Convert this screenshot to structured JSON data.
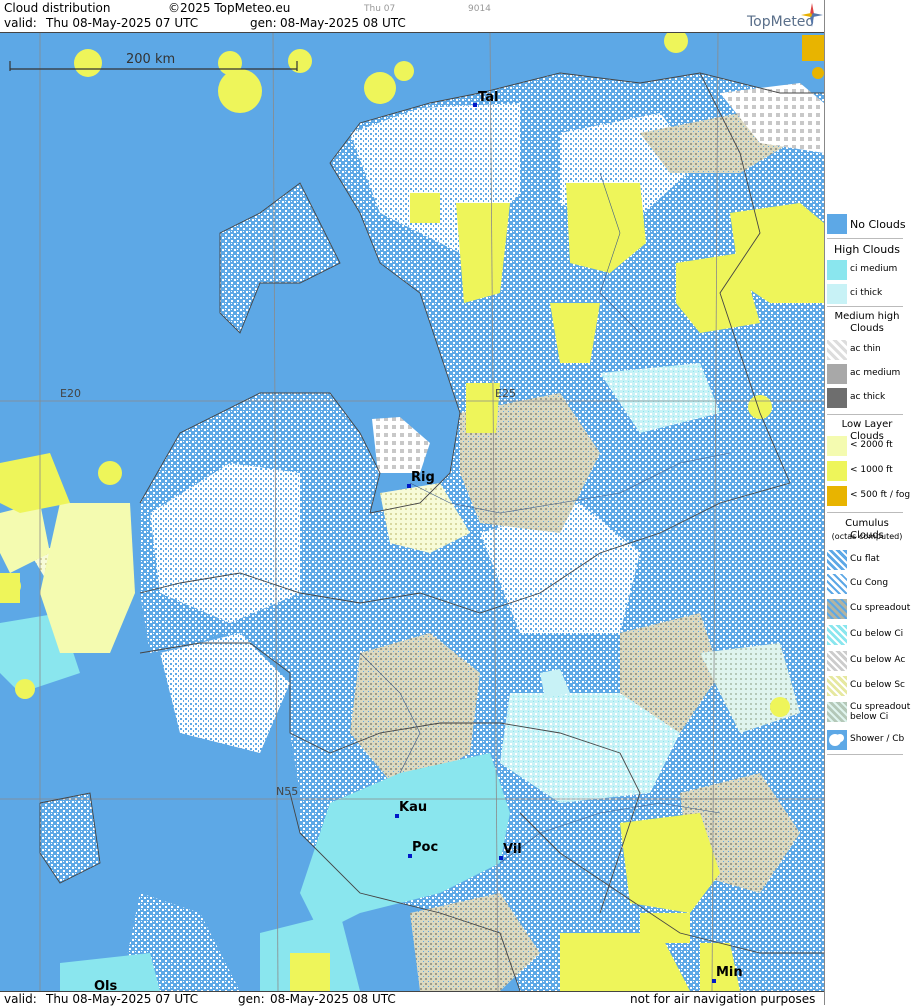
{
  "header": {
    "title": "Cloud distribution",
    "copyright": "©2025 TopMeteo.eu",
    "valid_label": "valid:",
    "valid_value": "Thu  08-May-2025  07 UTC",
    "gen_label": "gen:",
    "gen_value": "08-May-2025 08 UTC",
    "faint_day": "Thu 07",
    "faint_code": "9014",
    "brand": "TopMeteo"
  },
  "footer": {
    "valid_label": "valid:",
    "valid_value": "Thu  08-May-2025  07 UTC",
    "gen_label": "gen:",
    "gen_value": "08-May-2025 08 UTC",
    "disclaimer": "not for air navigation purposes"
  },
  "scale_bar": {
    "label": "200 km"
  },
  "grid_labels": {
    "e20": "E20",
    "e25": "E25",
    "n55": "N55"
  },
  "cities": {
    "tal": "Tal",
    "rig": "Rig",
    "kau": "Kau",
    "poc": "Poc",
    "vil": "Vil",
    "ols": "Ols",
    "min": "Min"
  },
  "legend": {
    "no_clouds": "No Clouds",
    "high_title": "High Clouds",
    "ci_medium": "ci medium",
    "ci_thick": "ci thick",
    "medium_title": "Medium high Clouds",
    "ac_thin": "ac thin",
    "ac_medium": "ac medium",
    "ac_thick": "ac thick",
    "low_title": "Low Layer Clouds",
    "lt2000": "< 2000 ft",
    "lt1000": "< 1000 ft",
    "lt500": "< 500 ft / fog",
    "cu_title": "Cumulus Clouds",
    "cu_sub": "(octas computed)",
    "cu_flat": "Cu flat",
    "cu_cong": "Cu Cong",
    "cu_spread": "Cu spreadout",
    "cu_below_ci": "Cu below Ci",
    "cu_below_ac": "Cu below Ac",
    "cu_below_sc": "Cu below Sc",
    "cu_spread_below_ci": "Cu spreadout below Ci",
    "shower": "Shower / Cb"
  },
  "colors": {
    "no_clouds": "#5da8e6",
    "ci_medium": "#8ae6ee",
    "ci_thick": "#c8f2f6",
    "lt2000": "#f4fbb0",
    "lt1000": "#eef55a",
    "lt500": "#e8b400"
  }
}
